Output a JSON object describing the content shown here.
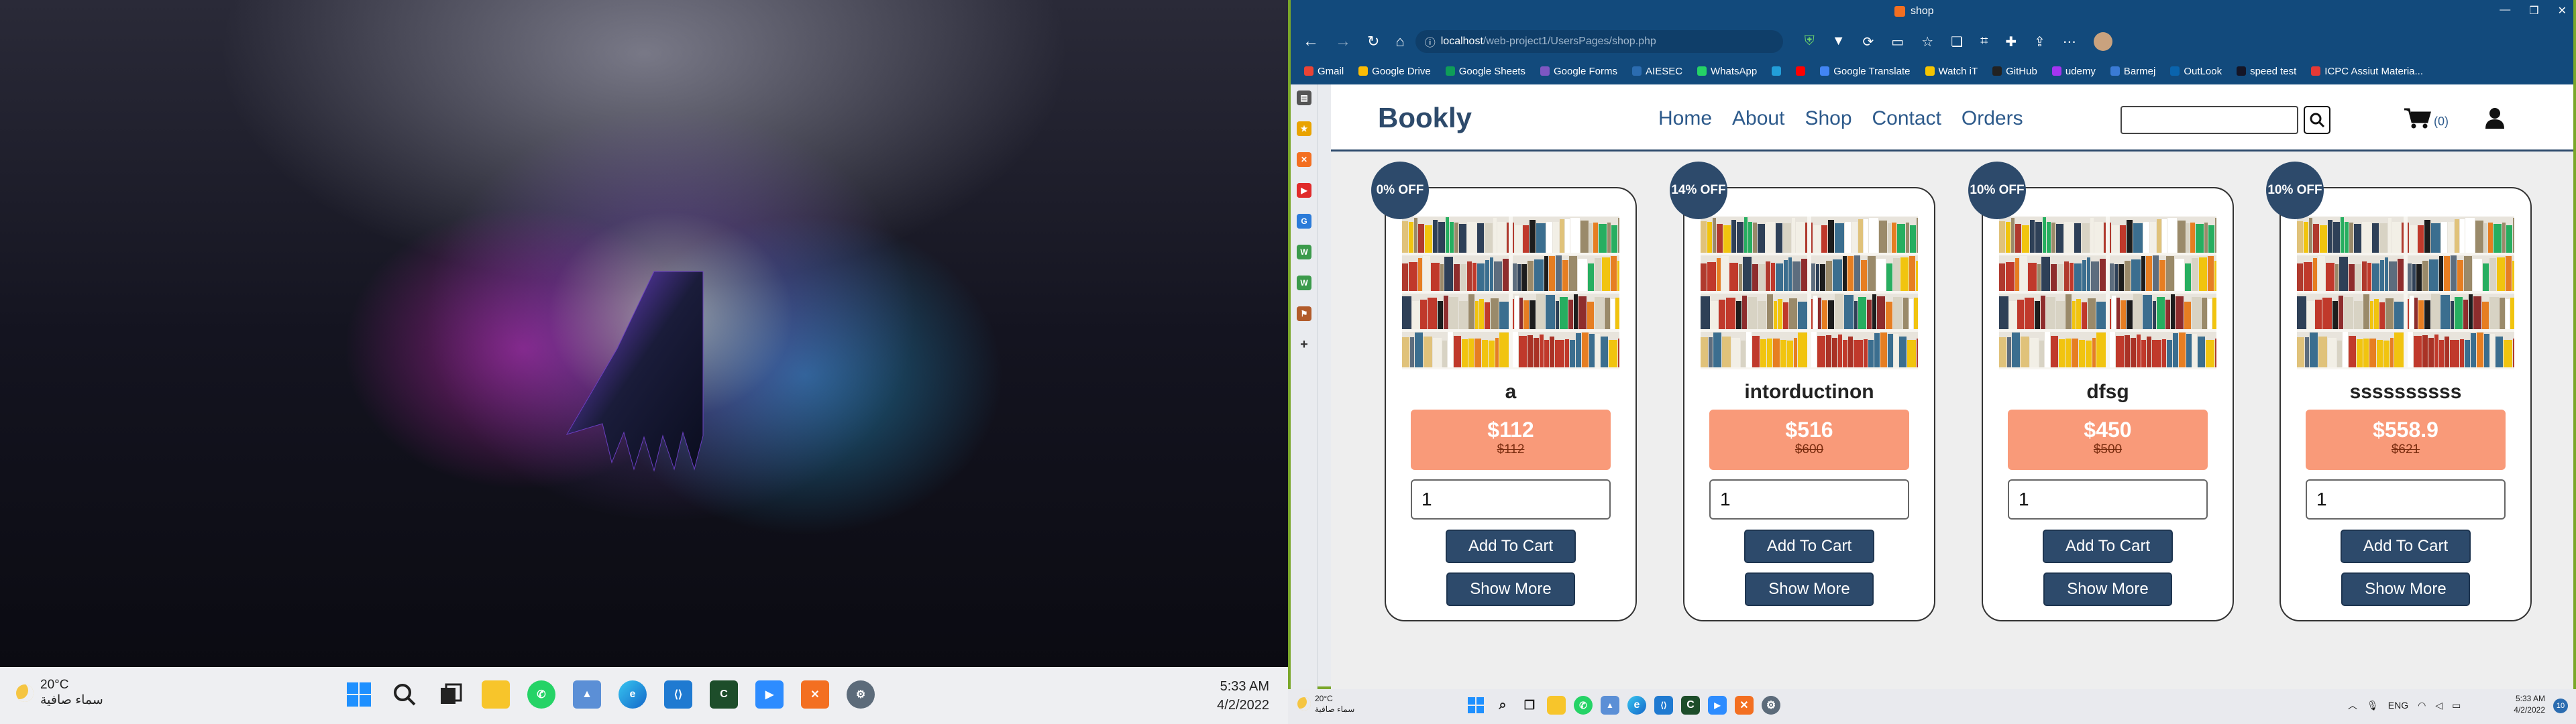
{
  "screen1": {
    "weather": {
      "temp": "20°C",
      "desc": "سماء صافية"
    },
    "clock": {
      "time": "5:33 AM",
      "date": "4/2/2022"
    }
  },
  "browser": {
    "tab_title": "shop",
    "url_host": "localhost",
    "url_path": "/web-project1/UsersPages/shop.php",
    "favorites": [
      {
        "label": "Gmail",
        "color": "#ea4335"
      },
      {
        "label": "Google Drive",
        "color": "#fbbc04"
      },
      {
        "label": "Google Sheets",
        "color": "#0f9d58"
      },
      {
        "label": "Google Forms",
        "color": "#7e57c2"
      },
      {
        "label": "AIESEC",
        "color": "#2b6cb0"
      },
      {
        "label": "WhatsApp",
        "color": "#25d366"
      },
      {
        "label": "",
        "color": "#229ed9"
      },
      {
        "label": "",
        "color": "#ff0000"
      },
      {
        "label": "Google Translate",
        "color": "#4285f4"
      },
      {
        "label": "Watch iT",
        "color": "#f5c400"
      },
      {
        "label": "GitHub",
        "color": "#222222"
      },
      {
        "label": "udemy",
        "color": "#a435f0"
      },
      {
        "label": "Barmej",
        "color": "#3a7bd5"
      },
      {
        "label": "OutLook",
        "color": "#0a64ad"
      },
      {
        "label": "speed test",
        "color": "#141526"
      },
      {
        "label": "ICPC Assiut Materia...",
        "color": "#e53935"
      }
    ]
  },
  "shop": {
    "brand": "Bookly",
    "nav": [
      "Home",
      "About",
      "Shop",
      "Contact",
      "Orders"
    ],
    "cart_count": "(0)",
    "add_label": "Add To Cart",
    "more_label": "Show More",
    "products": [
      {
        "name": "a",
        "discount": "0% OFF",
        "price": "$112",
        "old_price": "$112",
        "qty": "1"
      },
      {
        "name": "intorductinon",
        "discount": "14% OFF",
        "price": "$516",
        "old_price": "$600",
        "qty": "1"
      },
      {
        "name": "dfsg",
        "discount": "10% OFF",
        "price": "$450",
        "old_price": "$500",
        "qty": "1"
      },
      {
        "name": "ssssssssss",
        "discount": "10% OFF",
        "price": "$558.9",
        "old_price": "$621",
        "qty": "1"
      }
    ]
  },
  "screen2": {
    "weather": {
      "temp": "20°C",
      "desc": "سماء صافية"
    },
    "lang": "ENG",
    "clock": {
      "time": "5:33 AM",
      "date": "4/2/2022"
    },
    "notif_count": "10"
  }
}
